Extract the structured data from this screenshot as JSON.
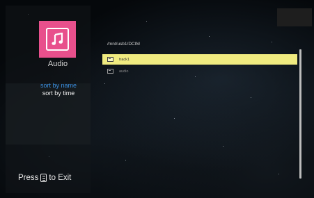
{
  "app": {
    "title": "Audio",
    "icon": "music-note-icon",
    "accent_color": "#e8508c"
  },
  "sort_menu": {
    "items": [
      {
        "label": "sort by name",
        "active": true
      },
      {
        "label": "sort by time",
        "active": false
      }
    ],
    "active_color": "#3a8fe0"
  },
  "footer": {
    "press_label": "Press",
    "key_icon": "menu-key-icon",
    "exit_label": "to Exit"
  },
  "browser": {
    "path": "/mnt/usb1/DCIM",
    "items": [
      {
        "name": "track1",
        "type": "folder",
        "selected": true
      },
      {
        "name": "audio",
        "type": "folder",
        "selected": false
      }
    ],
    "selection_color": "#f0eb80"
  }
}
